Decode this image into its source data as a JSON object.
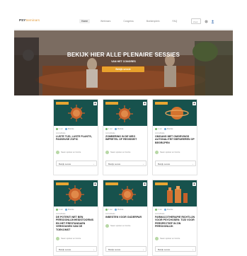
{
  "header": {
    "logo_main": "PSY",
    "logo_suffix": "Seminars",
    "nav": [
      "Home",
      "Webinars",
      "Congress",
      "Boekenplein",
      "FAQ"
    ],
    "search_placeholder": "Zoek"
  },
  "hero": {
    "title": "BEKIJK HIER ALLE PLENAIRE SESSIES",
    "subtitle": "VAN HET CONGRES",
    "button": "Bekijk sessie"
  },
  "cards": [
    {
      "meta1": "1 uur",
      "meta2": "Module",
      "category": "Accreditatie",
      "title": "LUSTE TIJD, LUSTE PLANTS, PASSEUSE ZOPIC",
      "speaker": "Naam spreker en functie",
      "button": "Bekijk sessie",
      "shape": "virus"
    },
    {
      "meta1": "1 uur",
      "meta2": "Module",
      "category": "Accreditatie",
      "title": "ZOMBERING IN DE WEG IMPRETEL OF REGISSEIT",
      "speaker": "Naam spreker en functie",
      "button": "Bekijk sessie",
      "shape": "virus"
    },
    {
      "meta1": "1 uur",
      "meta2": "Module",
      "category": "Accreditatie",
      "title": "OMGANG MET OMGEVINGS AUTONALITEIT BEPAREREN OP BEGRIJPEN",
      "speaker": "Naam spreker en functie",
      "button": "Bekijk sessie",
      "shape": "planet"
    },
    {
      "meta1": "1 uur",
      "meta2": "Module",
      "category": "Accreditatie",
      "title": "DE POTENTI NET BEN PERSOONLIJKHEIDSTOORNIS EN HET PRESTANDAEN VERHOUDEN VAN DE TOEKOMST",
      "speaker": "Naam spreker en functie",
      "button": "Bekijk sessie",
      "shape": "virus"
    },
    {
      "meta1": "1 uur",
      "meta2": "Module",
      "category": "Accreditatie",
      "title": "INBESTEN VOOR OUDERPAR",
      "speaker": "Naam spreker en functie",
      "button": "Bekijk sessie",
      "shape": "virus"
    },
    {
      "meta1": "1 uur",
      "meta2": "Module",
      "category": "Accreditatie",
      "title": "FARMACOTHERAPIE RICHTLIJN VOOR PSYCHOSEN: TIJD VOOR PERSPECTIEF IN ZIN PERSOONLIJK",
      "speaker": "Naam spreker en functie",
      "button": "Bekijk sessie",
      "shape": "bottles"
    }
  ],
  "colors": {
    "accent": "#e9a22c",
    "card_image_bg": "#17524d"
  }
}
